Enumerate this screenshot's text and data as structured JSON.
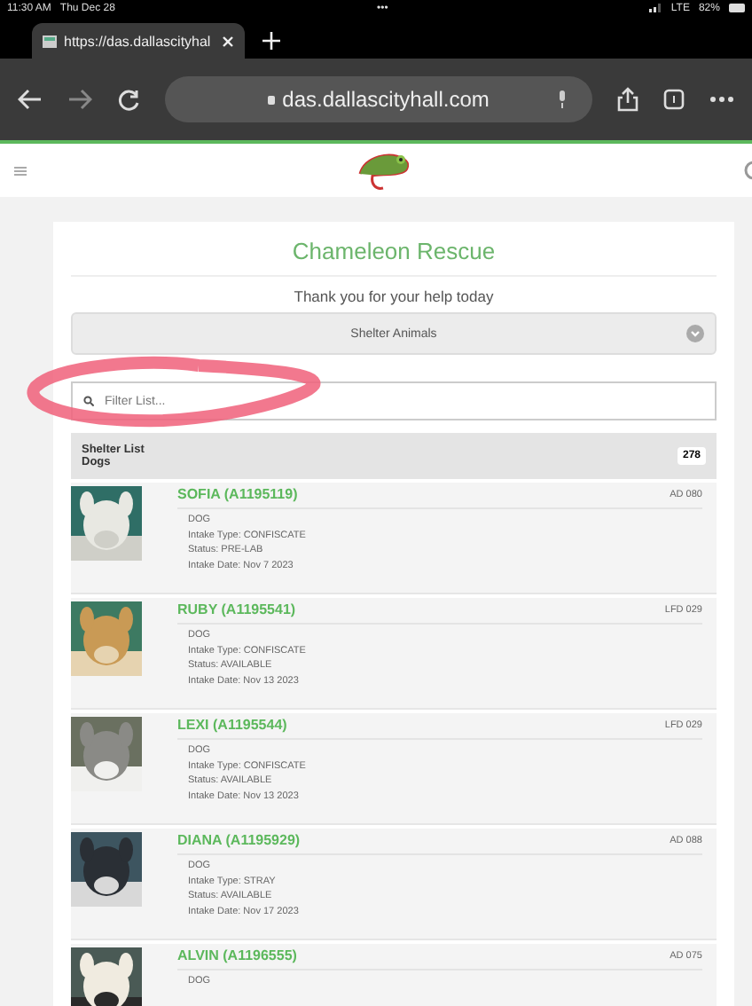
{
  "status_bar": {
    "time": "11:30 AM",
    "date": "Thu Dec 28",
    "dots": "•••",
    "network": "LTE",
    "battery": "82%"
  },
  "browser": {
    "tab_title": "https://das.dallascityhal",
    "url": "das.dallascityhall.com"
  },
  "page": {
    "title": "Chameleon Rescue",
    "subtitle": "Thank you for your help today",
    "select": {
      "value": "Shelter Animals"
    },
    "filter": {
      "placeholder": "Filter List..."
    },
    "list_header": {
      "title": "Shelter List",
      "subtitle": "Dogs",
      "count": "278"
    },
    "animals": [
      {
        "name": "SOFIA (A1195119)",
        "code": "AD 080",
        "details": [
          "DOG",
          "Intake Type: CONFISCATE",
          "Status: PRE-LAB",
          "Intake Date: Nov 7 2023"
        ]
      },
      {
        "name": "RUBY (A1195541)",
        "code": "LFD 029",
        "details": [
          "DOG",
          "Intake Type: CONFISCATE",
          "Status: AVAILABLE",
          "Intake Date: Nov 13 2023"
        ]
      },
      {
        "name": "LEXI (A1195544)",
        "code": "LFD 029",
        "details": [
          "DOG",
          "Intake Type: CONFISCATE",
          "Status: AVAILABLE",
          "Intake Date: Nov 13 2023"
        ]
      },
      {
        "name": "DIANA (A1195929)",
        "code": "AD 088",
        "details": [
          "DOG",
          "Intake Type: STRAY",
          "Status: AVAILABLE",
          "Intake Date: Nov 17 2023"
        ]
      },
      {
        "name": "ALVIN (A1196555)",
        "code": "AD 075",
        "details": [
          "DOG"
        ]
      }
    ]
  }
}
